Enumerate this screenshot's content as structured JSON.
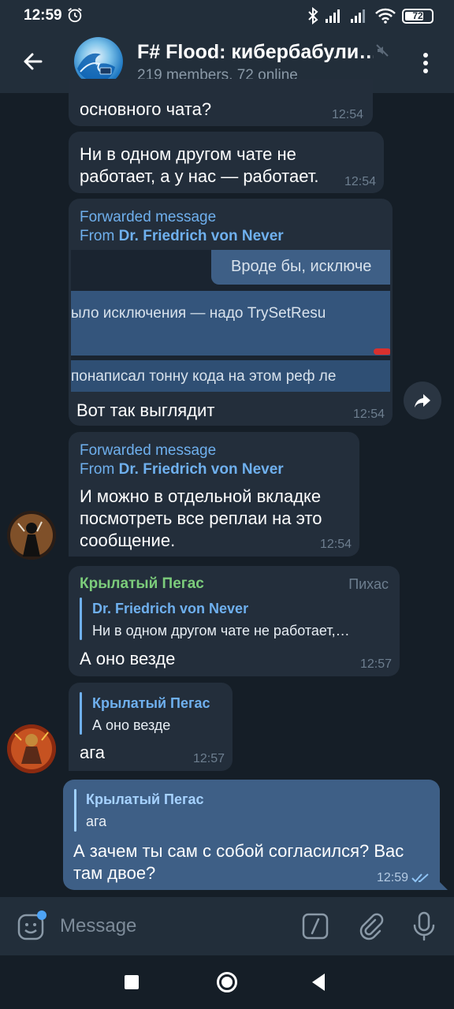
{
  "status_bar": {
    "time": "12:59",
    "battery": "72",
    "battery_level": 0.72
  },
  "header": {
    "title": "F# Flood: кибербабули…",
    "subtitle": "219 members, 72 online"
  },
  "messages": [
    {
      "text": "основного чата?",
      "time": "12:54"
    },
    {
      "text_lines": [
        "Ни в одном другом чате не",
        "работает, а у нас — работает."
      ],
      "time": "12:54"
    },
    {
      "forward_label": "Forwarded message",
      "forward_prefix": "From ",
      "forward_name": "Dr. Friedrich von Never",
      "image_lines": [
        "Вроде бы, исключе",
        "ыло исключения — надо TrySetResu",
        "понаписал тонну кода на этом реф ле"
      ],
      "text": "Вот так выглядит",
      "time": "12:54"
    },
    {
      "forward_label": "Forwarded message",
      "forward_prefix": "From ",
      "forward_name": "Dr. Friedrich von Never",
      "text_lines": [
        "И можно в отдельной вкладке",
        "посмотреть все реплаи на это",
        "сообщение."
      ],
      "time": "12:54"
    },
    {
      "sender": "Крылатый Пегас",
      "sender_tag": "Пихас",
      "reply_name": "Dr. Friedrich von Never",
      "reply_text": "Ни в одном другом чате не работает,…",
      "text": "А оно везде",
      "time": "12:57"
    },
    {
      "reply_name": "Крылатый Пегас",
      "reply_text": "А оно везде",
      "text": "ага",
      "time": "12:57"
    },
    {
      "reply_name": "Крылатый Пегас",
      "reply_text": "ага",
      "text_lines": [
        "А зачем ты сам с собой согласился? Вас",
        "там двое?"
      ],
      "time": "12:59"
    }
  ],
  "input": {
    "placeholder": "Message"
  },
  "colors": {
    "accent": "#6fb0ee",
    "sender_green": "#7ccc7b",
    "outgoing_bubble": "#3e5f86",
    "incoming_bubble": "#232e3b",
    "background": "#151e27"
  },
  "icons": [
    "alarm-icon",
    "bluetooth-icon",
    "signal-icon",
    "wifi-icon",
    "battery-icon",
    "back-arrow-icon",
    "muted-icon",
    "more-vert-icon",
    "share-icon",
    "emoji-icon",
    "bot-command-icon",
    "paperclip-icon",
    "microphone-icon"
  ]
}
